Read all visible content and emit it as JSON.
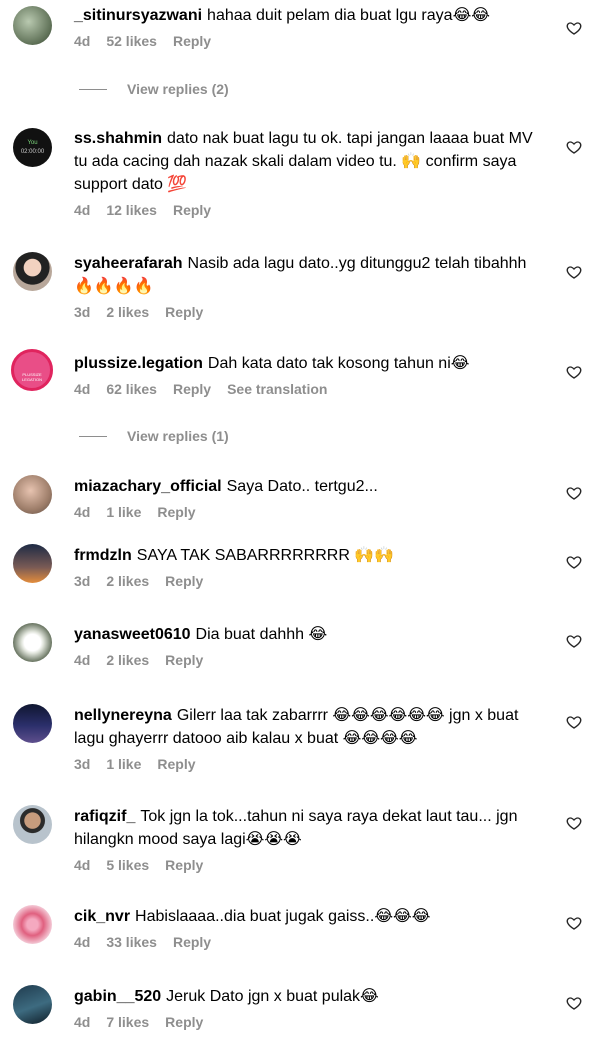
{
  "comments": [
    {
      "username": "_sitinursyazwani",
      "text": "hahaa duit pelam dia buat lgu raya",
      "emoji": "😂😂",
      "time": "4d",
      "likes": "52 likes",
      "reply": "Reply",
      "view_replies": "View replies (2)"
    },
    {
      "username": "ss.shahmin",
      "text": "dato nak buat lagu tu ok. tapi jangan laaaa buat MV tu ada cacing dah nazak skali dalam video tu. 🙌 confirm saya support dato 💯",
      "time": "4d",
      "likes": "12 likes",
      "reply": "Reply",
      "avatar_text": "You",
      "avatar_time": "02:00:00"
    },
    {
      "username": "syaheerafarah",
      "text": "Nasib ada lagu dato..yg ditunggu2 telah tibahhh🔥🔥🔥🔥",
      "time": "3d",
      "likes": "2 likes",
      "reply": "Reply"
    },
    {
      "username": "plussize.legation",
      "text": "Dah kata dato tak kosong tahun ni😂",
      "time": "4d",
      "likes": "62 likes",
      "reply": "Reply",
      "translation": "See translation",
      "view_replies": "View replies (1)",
      "avatar_text": "PLUSSIZE LEGATION"
    },
    {
      "username": "miazachary_official",
      "text": "Saya Dato.. tertgu2...",
      "time": "4d",
      "likes": "1 like",
      "reply": "Reply"
    },
    {
      "username": "frmdzln",
      "text": "SAYA TAK SABARRRRRRRR 🙌🙌",
      "time": "3d",
      "likes": "2 likes",
      "reply": "Reply"
    },
    {
      "username": "yanasweet0610",
      "text": "Dia buat dahhh 😂",
      "time": "4d",
      "likes": "2 likes",
      "reply": "Reply"
    },
    {
      "username": "nellynereyna",
      "text": "Gilerr laa tak zabarrrr 😂😂😂😂😂😂 jgn x buat lagu ghayerrr datooo aib kalau x buat 😂😂😂😂",
      "time": "3d",
      "likes": "1 like",
      "reply": "Reply"
    },
    {
      "username": "rafiqzif_",
      "text": "Tok jgn la tok...tahun ni saya raya dekat laut tau... jgn hilangkn mood saya lagi😭😭😭",
      "time": "4d",
      "likes": "5 likes",
      "reply": "Reply"
    },
    {
      "username": "cik_nvr",
      "text": "Habislaaaa..dia buat jugak gaiss..😂😂😂",
      "time": "4d",
      "likes": "33 likes",
      "reply": "Reply"
    },
    {
      "username": "gabin__520",
      "text": "Jeruk Dato jgn x buat pulak😂",
      "time": "4d",
      "likes": "7 likes",
      "reply": "Reply"
    }
  ],
  "colors": {
    "meta": "#8e8e8e",
    "text": "#000000",
    "background": "#ffffff"
  },
  "icons": {
    "like": "heart-outline-icon"
  }
}
